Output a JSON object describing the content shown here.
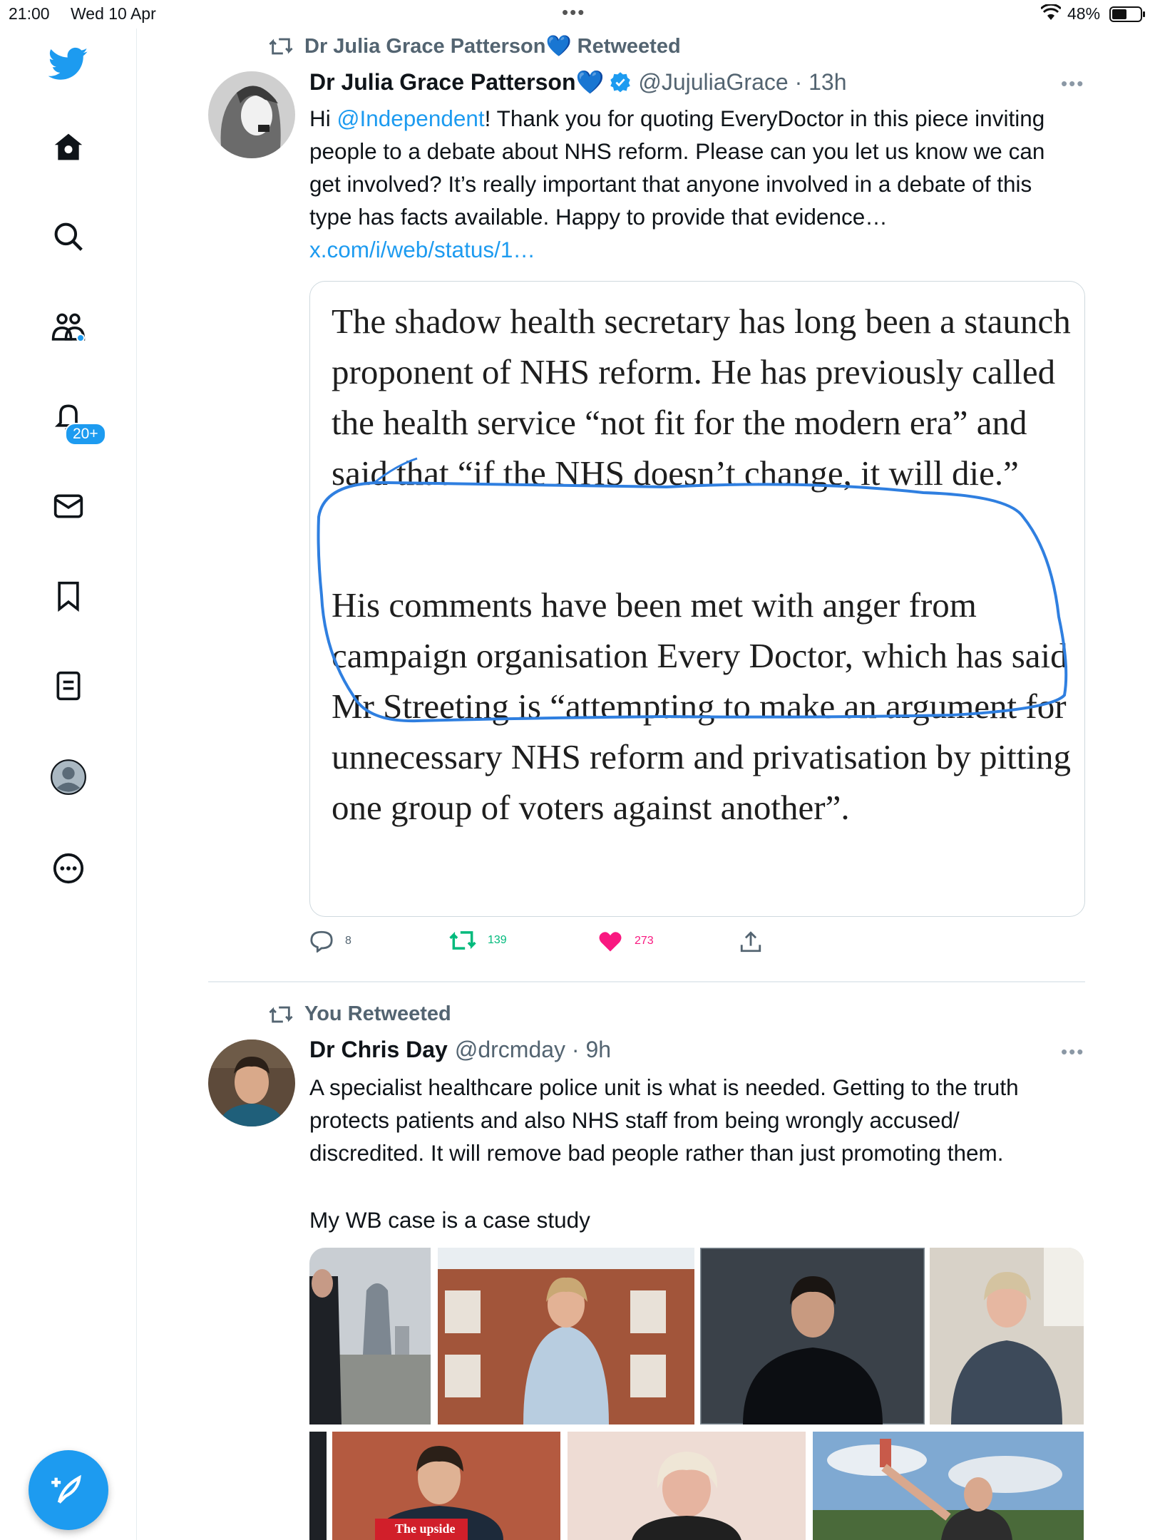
{
  "status_bar": {
    "time": "21:00",
    "date": "Wed 10 Apr",
    "battery": "48%"
  },
  "sidebar": {
    "items": [
      {
        "name": "logo"
      },
      {
        "name": "home"
      },
      {
        "name": "explore"
      },
      {
        "name": "communities"
      },
      {
        "name": "notifications"
      },
      {
        "name": "messages"
      },
      {
        "name": "bookmarks"
      },
      {
        "name": "lists"
      },
      {
        "name": "profile"
      },
      {
        "name": "more"
      }
    ],
    "notifications_badge": "20+"
  },
  "tweets": [
    {
      "retweet_label": "Dr Julia Grace Patterson💙 Retweeted",
      "name": "Dr Julia Grace Patterson💙",
      "handle_time": "@JujuliaGrace · 13h",
      "text_before_mention": "Hi ",
      "mention": "@Independent",
      "text_main": "! Thank you for quoting EveryDoctor in this piece inviting people to a debate about NHS reform. Please can you let us know we can get involved? It’s really important that anyone involved in a debate of this type has facts available. Happy to provide that evidence… ",
      "link": "x.com/i/web/status/1…",
      "quote_para_1": "The shadow health secretary has long been a staunch proponent of NHS reform. He has previously called the health service “not fit for the modern era” and said that “if the NHS doesn’t change, it will die.”",
      "quote_para_2": "His comments have been met with anger from campaign organisation Every Doctor, which has said Mr Streeting is “attempting to make an argument for unnecessary NHS reform and privatisation by pitting one group of voters against another”.",
      "replies": "8",
      "retweets": "139",
      "likes": "273"
    },
    {
      "retweet_label": "You Retweeted",
      "name": "Dr Chris Day",
      "handle_time": "@drcmday · 9h",
      "text": "A specialist healthcare police unit is what is needed. Getting to the truth protects patients and also NHS staff from being wrongly accused/ discredited. It will remove bad people rather than just promoting them.",
      "text_2": "My WB case is a case study",
      "media_caption": "The upside"
    }
  ],
  "colors": {
    "accent": "#1d9bf0",
    "retweet": "#00ba7c",
    "like": "#f91880",
    "muted": "#536471"
  }
}
